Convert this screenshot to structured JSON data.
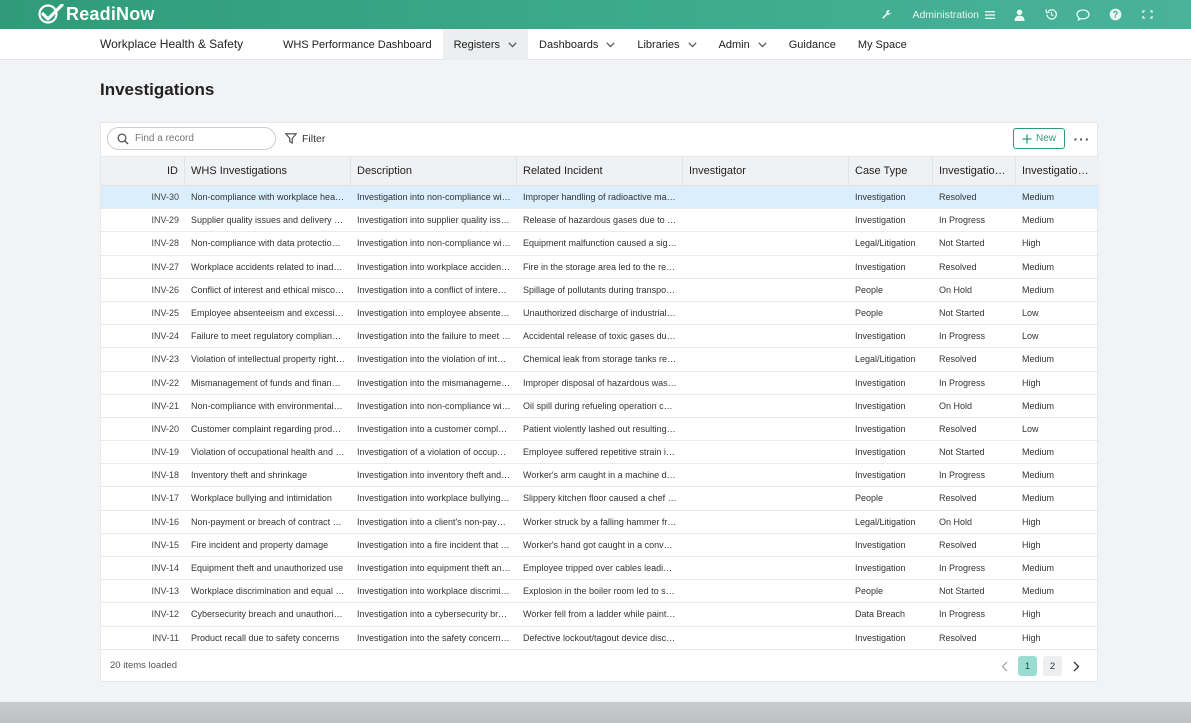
{
  "brand": {
    "name": "ReadiNow"
  },
  "topbar": {
    "admin_label": "Administration"
  },
  "nav": {
    "app_title": "Workplace Health & Safety",
    "items": [
      {
        "label": "WHS Performance Dashboard",
        "dropdown": false,
        "active": false
      },
      {
        "label": "Registers",
        "dropdown": true,
        "active": true
      },
      {
        "label": "Dashboards",
        "dropdown": true,
        "active": false
      },
      {
        "label": "Libraries",
        "dropdown": true,
        "active": false
      },
      {
        "label": "Admin",
        "dropdown": true,
        "active": false
      },
      {
        "label": "Guidance",
        "dropdown": false,
        "active": false
      },
      {
        "label": "My Space",
        "dropdown": false,
        "active": false
      }
    ]
  },
  "page": {
    "title": "Investigations",
    "search_placeholder": "Find a record",
    "filter_label": "Filter",
    "new_label": "New",
    "more_label": "···"
  },
  "columns": [
    "ID",
    "WHS Investigations",
    "Description",
    "Related Incident",
    "Investigator",
    "Case Type",
    "Investigation ...",
    "Investigation ..."
  ],
  "rows": [
    [
      "INV-30",
      "Non-compliance with workplace healt...",
      "Investigation into non-compliance wit...",
      "Improper handling of radioactive mate...",
      "",
      "Investigation",
      "Resolved",
      "Medium"
    ],
    [
      "INV-29",
      "Supplier quality issues and delivery del...",
      "Investigation into supplier quality issu...",
      "Release of hazardous gases due to a ...",
      "",
      "Investigation",
      "In Progress",
      "Medium"
    ],
    [
      "INV-28",
      "Non-compliance with data protection ...",
      "Investigation into non-compliance wit...",
      "Equipment malfunction caused a signi...",
      "",
      "Legal/Litigation",
      "Not Started",
      "High"
    ],
    [
      "INV-27",
      "Workplace accidents related to inadeq...",
      "Investigation into workplace accidents...",
      "Fire in the storage area led to the relea...",
      "",
      "Investigation",
      "Resolved",
      "Medium"
    ],
    [
      "INV-26",
      "Conflict of interest and ethical miscon...",
      "Investigation into a conflict of interest ...",
      "Spillage of pollutants during transport...",
      "",
      "People",
      "On Hold",
      "Medium"
    ],
    [
      "INV-25",
      "Employee absenteeism and excessive ...",
      "Investigation into employee absenteei...",
      "Unauthorized discharge of industrial w...",
      "",
      "People",
      "Not Started",
      "Low"
    ],
    [
      "INV-24",
      "Failure to meet regulatory compliance ...",
      "Investigation into the failure to meet r...",
      "Accidental release of toxic gases duri...",
      "",
      "Investigation",
      "In Progress",
      "Low"
    ],
    [
      "INV-23",
      "Violation of intellectual property rights...",
      "Investigation into the violation of intell...",
      "Chemical leak from storage tanks resu...",
      "",
      "Legal/Litigation",
      "Resolved",
      "Medium"
    ],
    [
      "INV-22",
      "Mismanagement of funds and financi...",
      "Investigation into the mismanagement...",
      "Improper disposal of hazardous waste...",
      "",
      "Investigation",
      "In Progress",
      "High"
    ],
    [
      "INV-21",
      "Non-compliance with environmental s...",
      "Investigation into non-compliance wit...",
      "Oil spill during refueling operation con...",
      "",
      "Investigation",
      "On Hold",
      "Medium"
    ],
    [
      "INV-20",
      "Customer complaint regarding produc...",
      "Investigation into a customer complai...",
      "Patient violently lashed out resulting i...",
      "",
      "Investigation",
      "Resolved",
      "Low"
    ],
    [
      "INV-19",
      "Violation of occupational health and s...",
      "Investigation of a violation of occupati...",
      "Employee suffered repetitive strain inj...",
      "",
      "Investigation",
      "Not Started",
      "Medium"
    ],
    [
      "INV-18",
      "Inventory theft and shrinkage",
      "Investigation into inventory theft and s...",
      "Worker's arm caught in a machine due...",
      "",
      "Investigation",
      "In Progress",
      "Medium"
    ],
    [
      "INV-17",
      "Workplace bullying and intimidation",
      "Investigation into workplace bullying a...",
      "Slippery kitchen floor caused a chef to...",
      "",
      "People",
      "Resolved",
      "Medium"
    ],
    [
      "INV-16",
      "Non-payment or breach of contract by ...",
      "Investigation into a client's non-payme...",
      "Worker struck by a falling hammer fro...",
      "",
      "Legal/Litigation",
      "On Hold",
      "High"
    ],
    [
      "INV-15",
      "Fire incident and property damage",
      "Investigation into a fire incident that c...",
      "Worker's hand got caught in a conveyo...",
      "",
      "Investigation",
      "Resolved",
      "High"
    ],
    [
      "INV-14",
      "Equipment theft and unauthorized use",
      "Investigation into equipment theft and...",
      "Employee tripped over cables leading t...",
      "",
      "Investigation",
      "In Progress",
      "Medium"
    ],
    [
      "INV-13",
      "Workplace discrimination and equal o...",
      "Investigation into workplace discrimin...",
      "Explosion in the boiler room led to sev...",
      "",
      "People",
      "Not Started",
      "Medium"
    ],
    [
      "INV-12",
      "Cybersecurity breach and unauthorize...",
      "Investigation into a cybersecurity brea...",
      "Worker fell from a ladder while paintin...",
      "",
      "Data Breach",
      "In Progress",
      "High"
    ],
    [
      "INV-11",
      "Product recall due to safety concerns",
      "Investigation into the safety concerns ...",
      "Defective lockout/tagout device disco...",
      "",
      "Investigation",
      "Resolved",
      "High"
    ]
  ],
  "footer": {
    "count_text": "20 items loaded",
    "pages": [
      "1",
      "2"
    ],
    "current_page": "1"
  }
}
